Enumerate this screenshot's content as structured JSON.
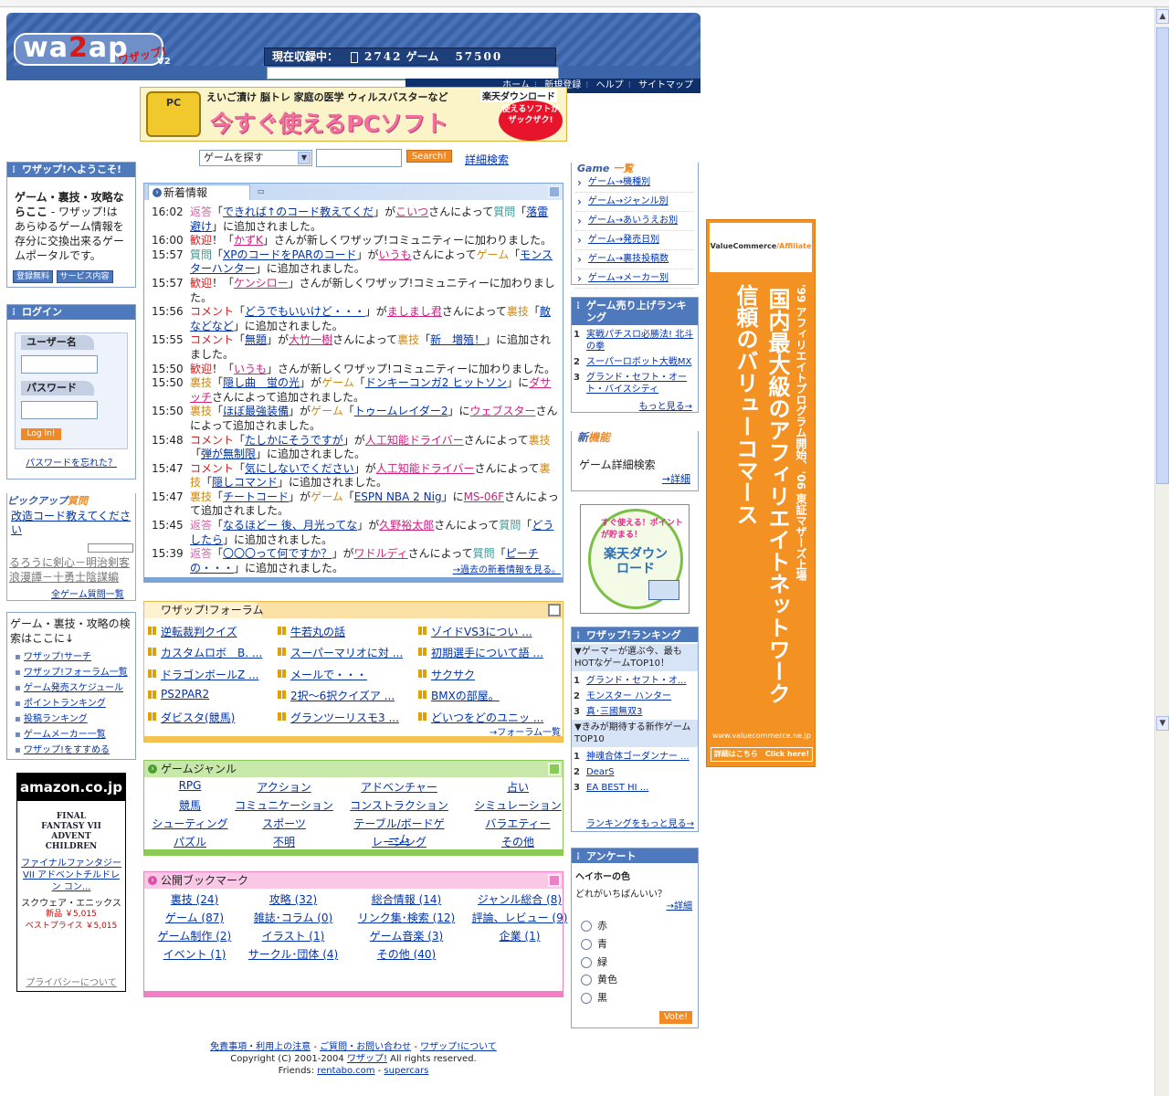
{
  "header": {
    "logo_text": "wa2ap",
    "logo_two": "2",
    "logo_sub": "ワザップ!",
    "logo_version": "V2",
    "counter_label": "現在収録中：",
    "counter_games": "2742",
    "counter_unit": "ゲーム",
    "counter_items": "57500",
    "nav": [
      "ホーム",
      "新規登録",
      "ヘルプ",
      "サイトマップ"
    ]
  },
  "banner": {
    "line1": "えいご漬け 脳トレ 家庭の医学 ウィルスバスターなど",
    "line2": "今すぐ使えるPCソフト",
    "rakuten": "楽天ダウンロード",
    "badge": "使えるソフトがザックザク!",
    "icon": "PC"
  },
  "search": {
    "select_value": "ゲームを探す",
    "button": "Search!",
    "advanced": "詳細検索"
  },
  "welcome": {
    "title": "ワザップ!へようこそ!",
    "text_bold": "ゲーム・裏技・攻略ならここ",
    "text_rest": " - ワザップ!はあらゆるゲーム情報を存分に交換出来るゲームポータルです。",
    "btn_register": "登録無料",
    "btn_service": "サービス内容"
  },
  "login": {
    "title": "ログイン",
    "user_label": "ユーザー名",
    "pass_label": "パスワード",
    "button": "Log In!",
    "forgot": "パスワードを忘れた？"
  },
  "pickup": {
    "title_a": "ピックアップ",
    "title_b": "質問",
    "q1": "改造コード教えてください",
    "q2": "るろうに剣心－明治剣客浪漫譚－十勇士陰謀編",
    "all": "全ゲーム質問一覧"
  },
  "find": {
    "heading": "ゲーム・裏技・攻略の検索はここに↓",
    "items": [
      "ワザップ!サーチ",
      "ワザップ!フォーラム一覧",
      "ゲーム発売スケジュール",
      "ポイントランキング",
      "投稿ランキング",
      "ゲームメーカー一覧",
      "ワザップ!をすすめる"
    ]
  },
  "amazon": {
    "logo": "amazon.co.jp",
    "cover": "FINAL FANTASY VII ADVENT CHILDREN",
    "title": "ファイナルファンタジーVII アドベントチルドレン コン...",
    "publisher": "スクウェア・エニックス",
    "price_new": "新品 ￥5,015",
    "price_best": "ベストプライス ￥5,015",
    "privacy": "プライバシーについて"
  },
  "news": {
    "title": "新着情報",
    "more": "→過去の新着情報を見る。",
    "rows": [
      {
        "time": "16:02",
        "html": "<span class='c-ans'>返答</span>「<a>できれば↑のコード教えてくだ</a>」が<span class='c-user'>こいつ</span>さんによって<span class='c-q'>質問</span>「<a>落雷避け</a>」に追加されました。"
      },
      {
        "time": "16:00",
        "html": "<span class='c-wel'>歓迎</span>！「<span class='c-user'>かずK</span>」さんが新しくワザップ!コミュニティーに加わりました。"
      },
      {
        "time": "15:57",
        "html": "<span class='c-q'>質問</span>「<a>XPのコードをPARのコード</a>」が<span class='c-user'>いうも</span>さんによって<span class='c-game'>ゲーム</span>「<a>モンスターハンター</a>」に追加されました。"
      },
      {
        "time": "15:57",
        "html": "<span class='c-wel'>歓迎</span>！「<span class='c-user'>ケンシロー</span>」さんが新しくワザップ!コミュニティーに加わりました。"
      },
      {
        "time": "15:56",
        "html": "<span class='c-com'>コメント</span>「<a>どうでもいいけど・・・</a>」が<span class='c-user'>ましまし君</span>さんによって<span class='c-ura'>裏技</span>「<a>敵などなど</a>」に追加されました。"
      },
      {
        "time": "15:55",
        "html": "<span class='c-com'>コメント</span>「<a>無題</a>」が<span class='c-user'>大竹一樹</span>さんによって<span class='c-ura'>裏技</span>「<a>新　増殖！</a>」に追加されました。"
      },
      {
        "time": "15:50",
        "html": "<span class='c-wel'>歓迎</span>！「<span class='c-user'>いうも</span>」さんが新しくワザップ!コミュニティーに加わりました。"
      },
      {
        "time": "15:50",
        "html": "<span class='c-ura'>裏技</span>「<a>隠し曲　蛍の光</a>」が<span class='c-game'>ゲーム</span>「<a>ドンキーコンガ2 ヒットソン</a>」に<span class='c-user'>ダサッチ</span>さんによって追加されました。"
      },
      {
        "time": "15:50",
        "html": "<span class='c-ura'>裏技</span>「<a>ほぼ最強装備</a>」が<span class='c-game'>ゲーム</span>「<a>トゥームレイダー2</a>」に<span class='c-user'>ウェブスター</span>さんによって追加されました。"
      },
      {
        "time": "15:48",
        "html": "<span class='c-com'>コメント</span>「<a>たしかにそうですが</a>」が<span class='c-user'>人工知能ドライバー</span>さんによって<span class='c-ura'>裏技</span>「<a>弾が無制限</a>」に追加されました。"
      },
      {
        "time": "15:47",
        "html": "<span class='c-com'>コメント</span>「<a>気にしないでください</a>」が<span class='c-user'>人工知能ドライバー</span>さんによって<span class='c-ura'>裏技</span>「<a>隠しコマンド</a>」に追加されました。"
      },
      {
        "time": "15:47",
        "html": "<span class='c-ura'>裏技</span>「<a>チートコード</a>」が<span class='c-game'>ゲーム</span>「<a>ESPN NBA 2 Nig</a>」に<span class='c-user'>MS-06F</span>さんによって追加されました。"
      },
      {
        "time": "15:45",
        "html": "<span class='c-ans'>返答</span>「<a>なるほどー 後、月光ってな</a>」が<span class='c-user'>久野裕太郎</span>さんによって<span class='c-q'>質問</span>「<a>どうしたら</a>」に追加されました。"
      },
      {
        "time": "15:39",
        "html": "<span class='c-ans'>返答</span>「<a>〇〇〇って何ですか？</a>」が<span class='c-user'>ワドルディ</span>さんによって<span class='c-q'>質問</span>「<a>ピーチの・・・</a>」に追加されました。"
      }
    ]
  },
  "forum": {
    "title": "ワザップ!フォーラム",
    "more": "→フォーラム一覧",
    "items": [
      "逆転裁判クイズ",
      "牛若丸の話",
      "ゾイドVS3につい ...",
      "カスタムロボ　B. ...",
      "スーパーマリオに対 ...",
      "初期選手について語 ...",
      "ドラゴンボールZ ...",
      "メールで・・・",
      "サクサク",
      "PS2PAR2",
      "2択～6択クイズア ...",
      "BMXの部屋。",
      "ダビスタ(競馬)",
      "グランツーリスモ3 ...",
      "どいつをどのユニッ ..."
    ]
  },
  "genre": {
    "title": "ゲームジャンル",
    "items": [
      "RPG",
      "アクション",
      "アドベンチャー",
      "占い",
      "競馬",
      "コミュニケーション",
      "コンストラクション",
      "シミュレーション",
      "シューティング",
      "スポーツ",
      "テーブル/ボードゲーム",
      "バラエティー",
      "パズル",
      "不明",
      "レーシング",
      "その他"
    ]
  },
  "bookmark": {
    "title": "公開ブックマーク",
    "items": [
      "裏技 (24)",
      "攻略 (32)",
      "総合情報 (14)",
      "ジャンル総合 (8)",
      "ゲーム (87)",
      "雑誌･コラム (0)",
      "リンク集･検索 (12)",
      "評論、レビュー (9)",
      "ゲーム制作 (2)",
      "イラスト (1)",
      "ゲーム音楽 (3)",
      "企業 (1)",
      "イベント (1)",
      "サークル･団体 (4)",
      "その他 (40)"
    ]
  },
  "footer": {
    "links": [
      "免責事項・利用上の注意",
      "ご質問・お問い合わせ",
      "ワザップ!について"
    ],
    "sep": " - ",
    "copyright_a": "Copyright (C) 2001-2004 ",
    "copyright_link": "ワザップ!",
    "copyright_b": " All rights reserved.",
    "friends_label": "Friends: ",
    "friends": [
      "rentabo.com",
      "supercars"
    ]
  },
  "gamelist": {
    "title_a": "Game",
    "title_b": "一覧",
    "items": [
      "ゲーム→機種別",
      "ゲーム→ジャンル別",
      "ゲーム→あいうえお別",
      "ゲーム→発売日別",
      "ゲーム→裏技投稿数",
      "ゲーム→メーカー別"
    ]
  },
  "sales": {
    "title": "ゲーム売り上げランキング",
    "items": [
      {
        "n": "1",
        "t": "実戦パチスロ必勝法! 北斗の拳"
      },
      {
        "n": "2",
        "t": "スーパーロボット大戦MX"
      },
      {
        "n": "3",
        "t": "グランド・セフト・オート・バイスシティ"
      }
    ],
    "more": "もっと見る→"
  },
  "newfeat": {
    "title_a": "新",
    "title_b": "機能",
    "text": "ゲーム詳細検索",
    "link": "→詳細"
  },
  "rakuten_ad": {
    "arc": "すぐ使える！ポイントが貯まる！",
    "title": "楽天ダウンロード",
    "side": "今すぐ使える"
  },
  "wranking": {
    "title": "ワザップ!ランキング",
    "sec1": "▼ゲーマーが選ぶ今、最もHOTなゲームTOP10！",
    "list1": [
      {
        "n": "1",
        "t": "グランド・セフト・オ..."
      },
      {
        "n": "2",
        "t": "モンスター ハンター"
      },
      {
        "n": "3",
        "t": "真･三國無双3"
      }
    ],
    "sec2": "▼きみが期待する新作ゲームTOP10",
    "list2": [
      {
        "n": "1",
        "t": "神魂合体ゴーダンナー ..."
      },
      {
        "n": "2",
        "t": "DearS"
      },
      {
        "n": "3",
        "t": "EA BEST HI ..."
      }
    ],
    "more": "ランキングをもっと見る→"
  },
  "enquete": {
    "title": "アンケート",
    "q1": "ヘイホーの色",
    "q2": "どれがいちばんいい？",
    "detail": "→詳細",
    "options": [
      "赤",
      "青",
      "緑",
      "黄色",
      "黒"
    ],
    "vote": "Vote!"
  },
  "vcad": {
    "top_a": "ValueCommerce",
    "top_b": "/Affiliate",
    "line1": "'99 アフィリエイトプログラム開始、'06 東証マザーズ上場",
    "line2": "国内最大級のアフィリエイトネットワーク",
    "line3": "信頼のバリューコマース",
    "url": "www.valuecommerce.ne.jp",
    "click": "詳細はこちら　Click here!"
  }
}
